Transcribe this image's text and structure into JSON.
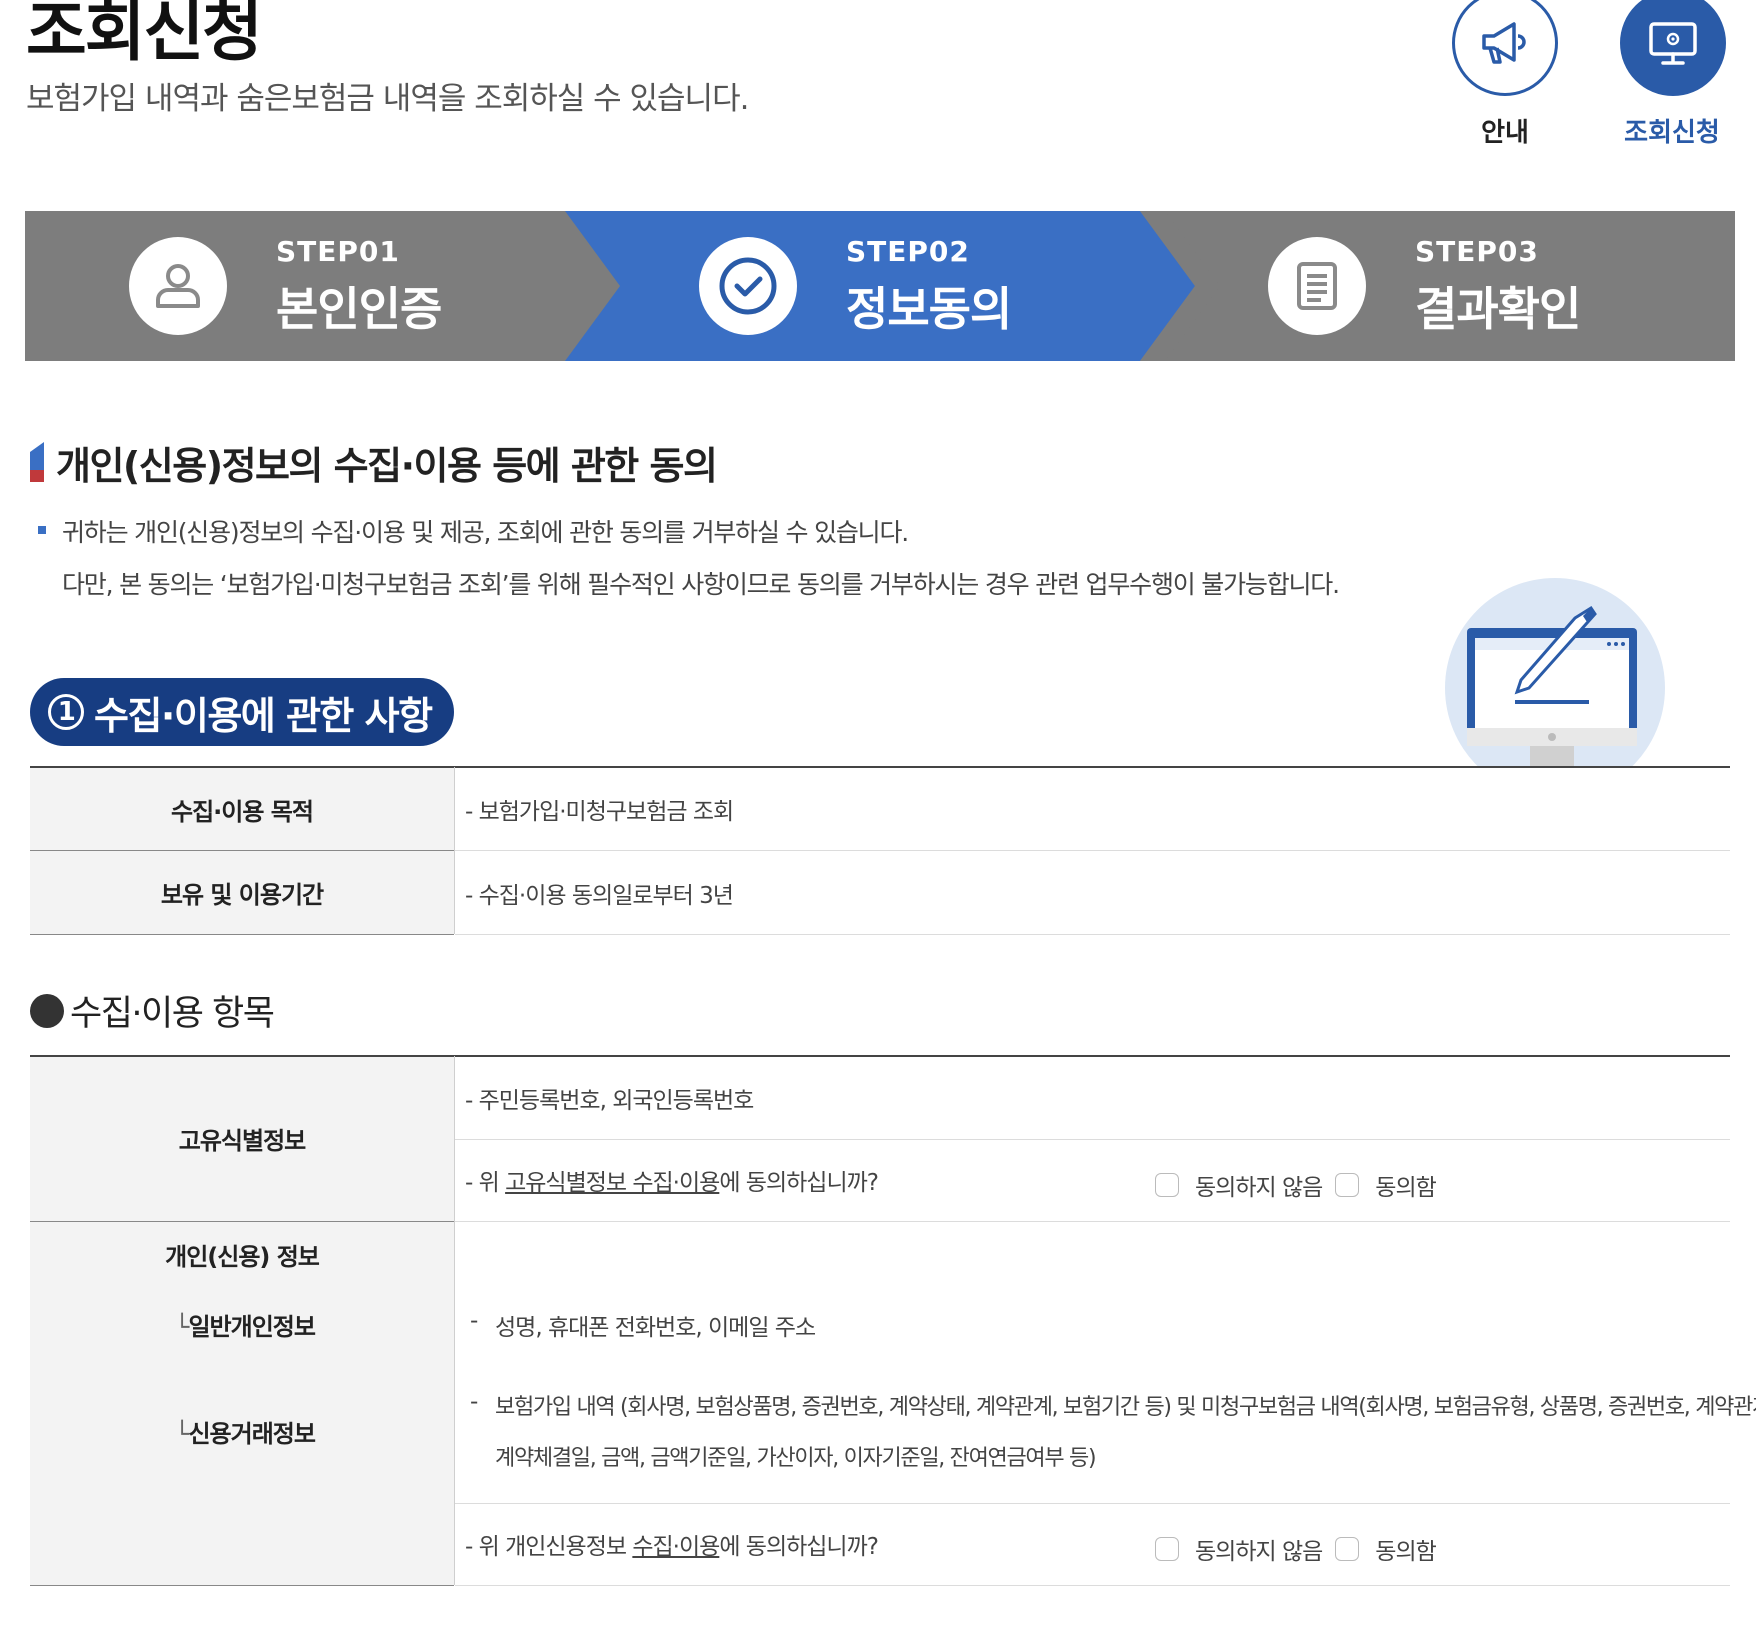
{
  "header": {
    "title": "조회신청",
    "subtitle": "보험가입 내역과 숨은보험금 내역을 조회하실 수 있습니다.",
    "shortcuts": [
      {
        "label": "안내",
        "icon": "megaphone-icon"
      },
      {
        "label": "조회신청",
        "icon": "monitor-icon"
      }
    ]
  },
  "steps": [
    {
      "code": "STEP01",
      "name": "본인인증",
      "icon": "user-icon",
      "active": false
    },
    {
      "code": "STEP02",
      "name": "정보동의",
      "icon": "check-circle-icon",
      "active": true
    },
    {
      "code": "STEP03",
      "name": "결과확인",
      "icon": "document-icon",
      "active": false
    }
  ],
  "colors": {
    "active_step": "#3a6fc4",
    "inactive_step": "#7d7d7d",
    "navy": "#173d82",
    "accent": "#2a5ba8"
  },
  "section": {
    "title": "개인(신용)정보의 수집·이용 등에 관한 동의",
    "notice_line1": "귀하는 개인(신용)정보의 수집·이용 및 제공, 조회에 관한 동의를 거부하실 수 있습니다.",
    "notice_line2": "다만, 본 동의는 ‘보험가입·미청구보험금 조회’를 위해 필수적인 사항이므로 동의를 거부하시는 경우 관련 업무수행이 불가능합니다."
  },
  "pill": {
    "number": "1",
    "label": "수집·이용에 관한 사항"
  },
  "purpose_table": [
    {
      "label": "수집·이용 목적",
      "value": "- 보험가입·미청구보험금 조회"
    },
    {
      "label": "보유 및 이용기간",
      "value": "- 수집·이용 동의일로부터 3년"
    }
  ],
  "items_heading": "수집·이용 항목",
  "unique_info": {
    "label": "고유식별정보",
    "value": "- 주민등록번호, 외국인등록번호",
    "question_prefix": "- 위 ",
    "question_link": "고유식별정보 수집·이용",
    "question_suffix": "에 동의하십니까?",
    "disagree": "동의하지 않음",
    "agree": "동의함"
  },
  "credit_info": {
    "label": "개인(신용) 정보",
    "sub1": "일반개인정보",
    "sub2": "신용거래정보",
    "value1_dash": "-",
    "value1": "성명, 휴대폰 전화번호, 이메일 주소",
    "value2_dash": "-",
    "value2_line1": "보험가입 내역 (회사명, 보험상품명, 증권번호, 계약상태, 계약관계, 보험기간 등) 및 미청구보험금 내역(회사명, 보험금유형, 상품명, 증권번호, 계약관계,",
    "value2_line2": "계약체결일, 금액, 금액기준일, 가산이자, 이자기준일, 잔여연금여부 등)",
    "question_prefix": "- 위 개인신용정보 ",
    "question_link": "수집·이용",
    "question_suffix": "에 동의하십니까?",
    "disagree": "동의하지 않음",
    "agree": "동의함"
  }
}
